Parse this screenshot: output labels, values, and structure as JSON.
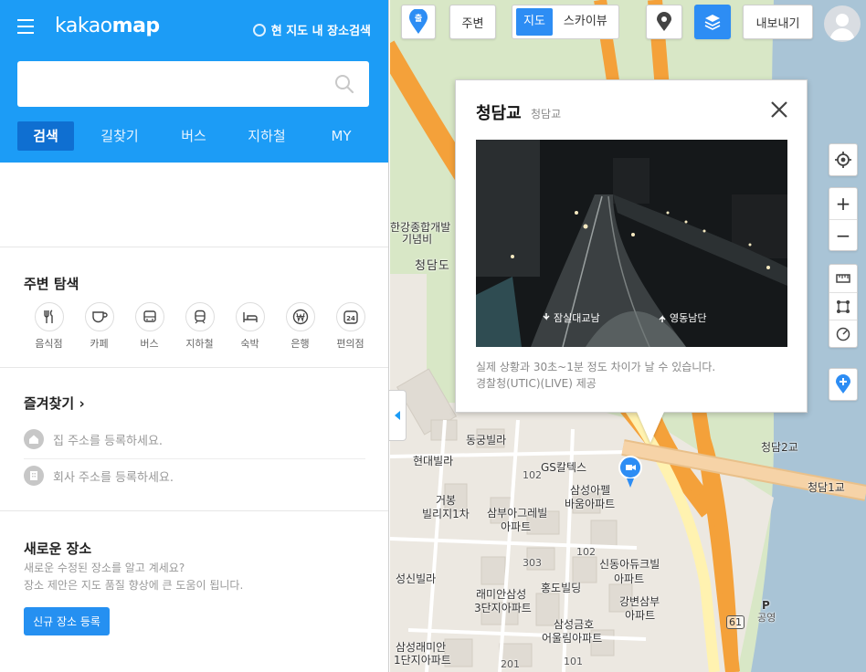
{
  "sidebar": {
    "logo_light": "kakao",
    "logo_bold": "map",
    "here_search": "현 지도 내 장소검색",
    "search_placeholder": "",
    "tabs": [
      "검색",
      "길찾기",
      "버스",
      "지하철",
      "MY"
    ],
    "nearby": {
      "title": "주변 탐색",
      "categories": [
        {
          "icon": "restaurant-icon",
          "label": "음식점"
        },
        {
          "icon": "cafe-icon",
          "label": "카페"
        },
        {
          "icon": "bus-icon",
          "label": "버스"
        },
        {
          "icon": "subway-icon",
          "label": "지하철"
        },
        {
          "icon": "hotel-icon",
          "label": "숙박"
        },
        {
          "icon": "bank-icon",
          "label": "은행"
        },
        {
          "icon": "convenience-store-icon",
          "label": "편의점"
        }
      ]
    },
    "favorites": {
      "title": "즐겨찾기",
      "home": "집 주소를 등록하세요.",
      "work": "회사 주소를 등록하세요."
    },
    "new_place": {
      "title": "새로운 장소",
      "desc1": "새로운 수정된 장소를 알고 계세요?",
      "desc2": "장소 제안은 지도 품질 향상에 큰 도움이 됩니다.",
      "button": "신규 장소 등록"
    }
  },
  "map_toolbar": {
    "start_badge": "출",
    "nearby": "주변",
    "map": "지도",
    "skyview": "스카이뷰",
    "export": "내보내기"
  },
  "popup": {
    "title": "청담교",
    "subtitle": "청담교",
    "cctv_left": "잠실대교남",
    "cctv_right": "영동남단",
    "note1": "실제 상황과 30초~1분 정도 차이가 날 수 있습니다.",
    "note2": "경찰청(UTIC)(LIVE) 제공"
  },
  "map_labels": {
    "hangang": "한강종합개발",
    "memorial": "기념비",
    "cheongdamdo": "청담도",
    "cheongdam2": "청담2교",
    "cheongdam1": "청담1교",
    "dongkung": "동궁빌라",
    "hyundai": "현대빌라",
    "gs": "GS칼텍스",
    "geobong1": "거봉",
    "geobong2": "빌리지1차",
    "samsungapel1": "삼성아펠",
    "samsungapel2": "바움아파트",
    "samboo1": "삼부아그레빌",
    "samboo2": "아파트",
    "shindong1": "신동아듀크빌",
    "shindong2": "아파트",
    "sungshin": "성신빌라",
    "raemian1": "래미안삼성",
    "raemian2": "3단지아파트",
    "hongdo": "홍도빌딩",
    "gangbyeon1": "강변삼부",
    "gangbyeon2": "아파트",
    "samsungkumho1": "삼성금호",
    "samsungkumho2": "어울림아파트",
    "raemian1b1": "삼성래미안",
    "raemian1b2": "1단지아파트",
    "no102a": "102",
    "no102b": "102",
    "no303": "303",
    "no201": "201",
    "no101": "101",
    "route61": "61",
    "parking": "공영",
    "parking_p": "P"
  },
  "colors": {
    "brand_blue": "#1c9cf6",
    "tab_active": "#0f6fd1",
    "highway_orange": "#f4a13a",
    "river": "#a9c4d6"
  }
}
